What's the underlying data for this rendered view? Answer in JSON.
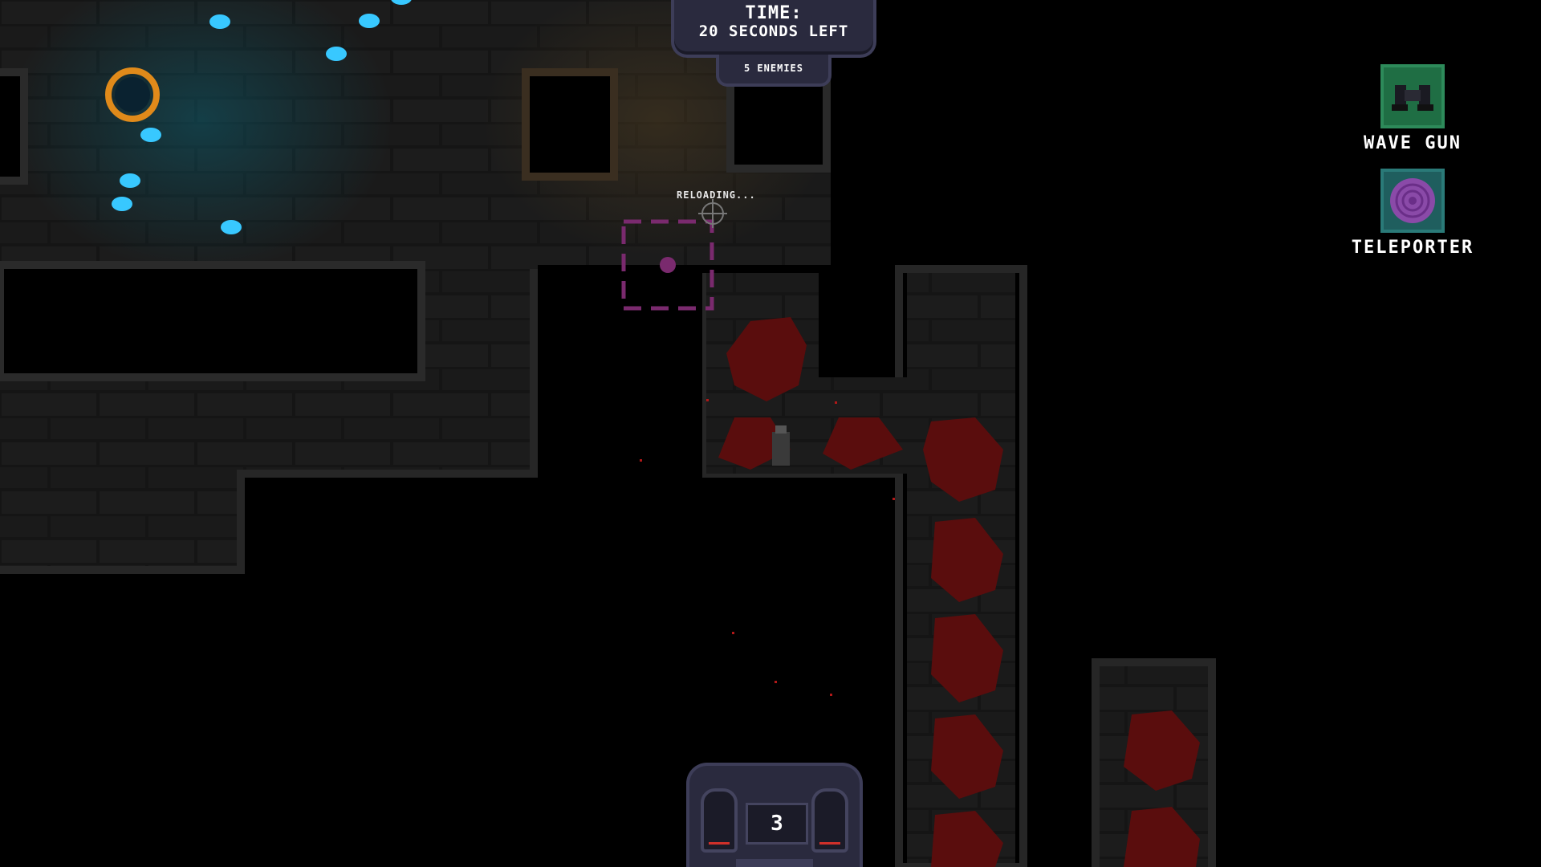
{
  "hud": {
    "timer_title": "TIME:",
    "timer_text": "20 SECONDS LEFT",
    "enemies_text": "5 ENEMIES",
    "reload_text": "RELOADING...",
    "ammo_count": "3"
  },
  "abilities": [
    {
      "label": "WAVE GUN",
      "icon": "binoculars-gun-icon",
      "tile_color": "#1f6e44"
    },
    {
      "label": "TELEPORTER",
      "icon": "purple-portal-icon",
      "tile_color": "#1f5e5e"
    }
  ],
  "colors": {
    "floor": "#1a1a1a",
    "wall": "#252525",
    "blood": "#5a0d0d",
    "gem": "#38c8ff",
    "portal": "#e08a1a",
    "teleporter_marker": "#8a2a7a",
    "hud_panel": "#2a2a3e"
  }
}
